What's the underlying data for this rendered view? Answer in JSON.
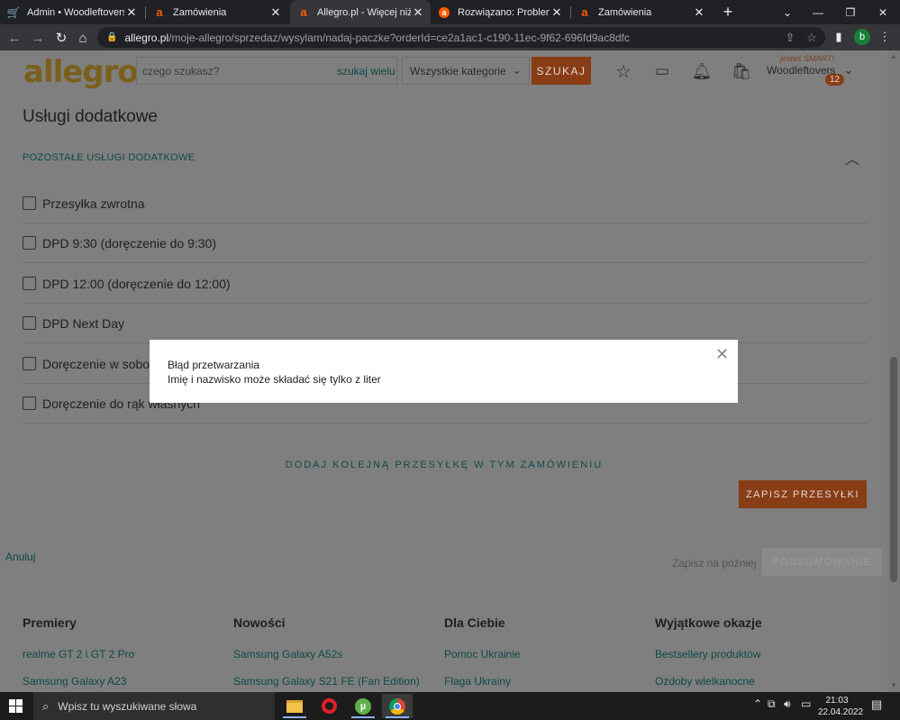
{
  "browser": {
    "tabs": [
      {
        "title": "Admin • Woodleftovers",
        "icon": "cart-icon"
      },
      {
        "title": "Zamówienia",
        "icon": "allegro-icon"
      },
      {
        "title": "Allegro.pl - Więcej niż aukcje",
        "icon": "allegro-icon",
        "active": true
      },
      {
        "title": "Rozwiązano: Problem z nadaniem",
        "icon": "allegro-community-icon"
      },
      {
        "title": "Zamówienia",
        "icon": "allegro-icon"
      }
    ],
    "url_host": "allegro.pl",
    "url_path": "/moje-allegro/sprzedaz/wysylam/nadaj-paczke?orderId=ce2a1ac1-c190-11ec-9f62-696fd9ac8dfc",
    "profile_initial": "b"
  },
  "header": {
    "logo": "allegro",
    "search_placeholder": "czego szukasz?",
    "search_many": "szukaj wielu",
    "category": "Wszystkie kategorie",
    "search_button": "SZUKAJ",
    "smart": "jesteś SMART!",
    "user": "Woodleftovers",
    "user_count": "12"
  },
  "section": {
    "title": "Usługi dodatkowe",
    "toggle": "POZOSTAŁE USŁUGI DODATKOWE",
    "options": [
      "Przesyłka zwrotna",
      "DPD 9:30 (doręczenie do 9:30)",
      "DPD 12:00 (doręczenie do 12:00)",
      "DPD Next Day",
      "Doręczenie w sobotę",
      "Doręczenie do rąk własnych"
    ],
    "add_shipment": "DODAJ KOLEJNĄ PRZESYŁKĘ W TYM ZAMÓWIENIU",
    "save_button": "ZAPISZ PRZESYŁKI"
  },
  "actions": {
    "cancel": "Anuluj",
    "save_later": "Zapisz na później",
    "summary": "PODSUMOWANIE"
  },
  "footer": {
    "columns": [
      {
        "heading": "Premiery",
        "links": [
          "realme GT 2 i GT 2 Pro",
          "Samsung Galaxy A23"
        ]
      },
      {
        "heading": "Nowości",
        "links": [
          "Samsung Galaxy A52s",
          "Samsung Galaxy S21 FE (Fan Edition)"
        ]
      },
      {
        "heading": "Dla Ciebie",
        "links": [
          "Pomoc Ukrainie",
          "Flaga Ukrainy"
        ]
      },
      {
        "heading": "Wyjątkowe okazje",
        "links": [
          "Bestsellery produktów",
          "Ozdoby wielkanocne"
        ]
      }
    ]
  },
  "modal": {
    "title": "Błąd przetwarzania",
    "message": "Imię i nazwisko może składać się tylko z liter"
  },
  "taskbar": {
    "search_placeholder": "Wpisz tu wyszukiwane słowa",
    "time": "21:03",
    "date": "22.04.2022",
    "apps": [
      "file-explorer-icon",
      "opera-icon",
      "utorrent-icon",
      "chrome-icon"
    ]
  }
}
